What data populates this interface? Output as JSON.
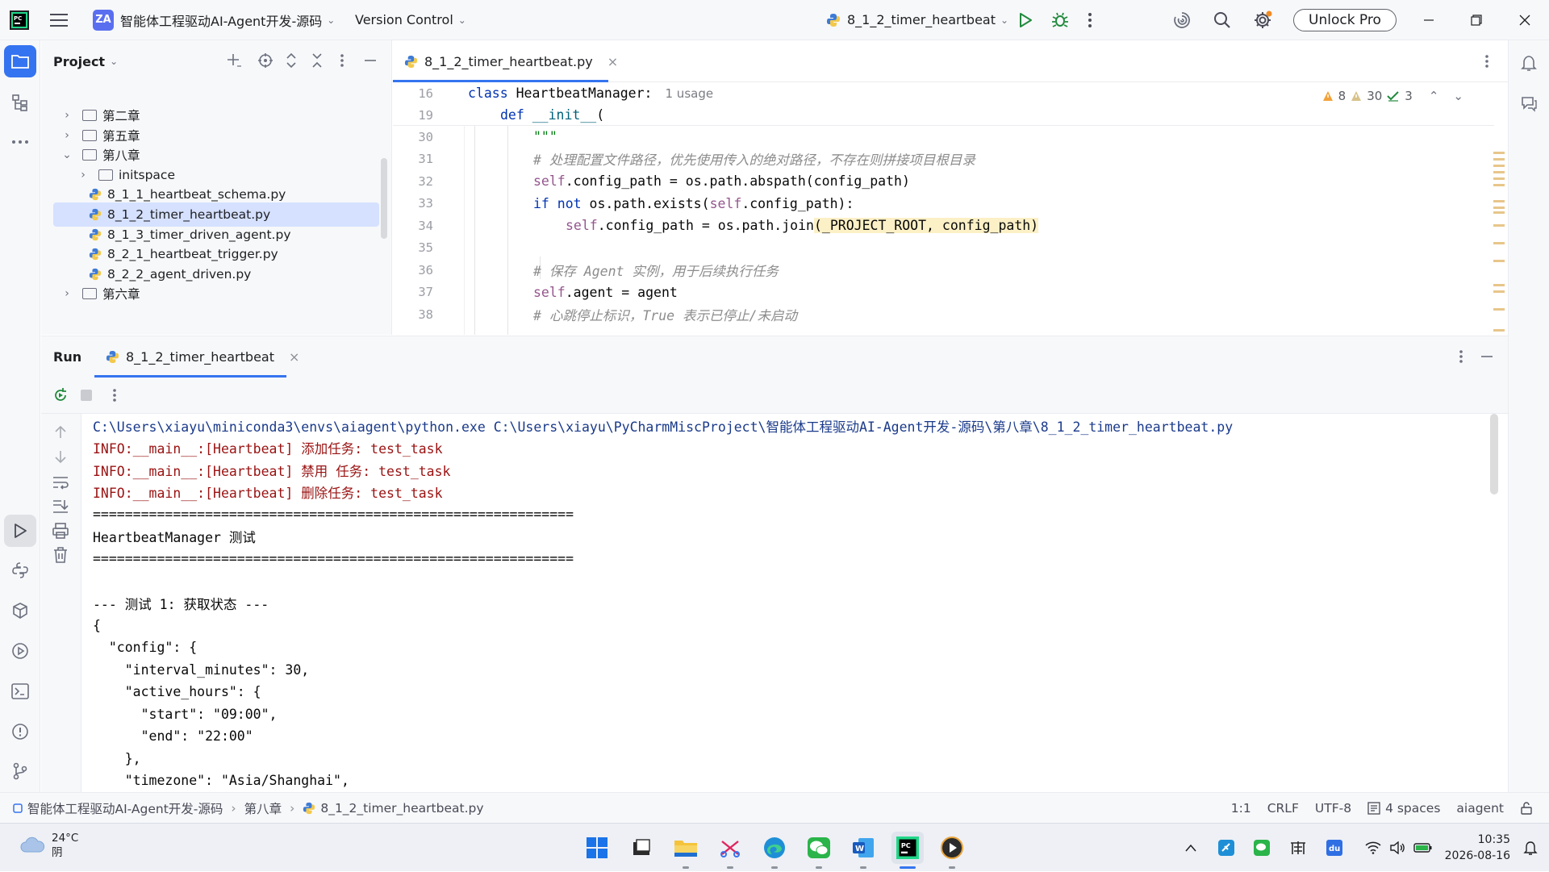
{
  "titlebar": {
    "project_badge": "ZA",
    "project_name": "智能体工程驱动AI-Agent开发-源码",
    "vcs": "Version Control",
    "run_config": "8_1_2_timer_heartbeat",
    "unlock": "Unlock Pro"
  },
  "project_panel": {
    "title": "Project",
    "tree": [
      {
        "label": "第二章",
        "kind": "folder",
        "expanded": false
      },
      {
        "label": "第五章",
        "kind": "folder",
        "expanded": false
      },
      {
        "label": "第八章",
        "kind": "folder",
        "expanded": true
      },
      {
        "label": "initspace",
        "kind": "folder",
        "expanded": false
      },
      {
        "label": "8_1_1_heartbeat_schema.py",
        "kind": "py"
      },
      {
        "label": "8_1_2_timer_heartbeat.py",
        "kind": "py",
        "selected": true
      },
      {
        "label": "8_1_3_timer_driven_agent.py",
        "kind": "py"
      },
      {
        "label": "8_2_1_heartbeat_trigger.py",
        "kind": "py"
      },
      {
        "label": "8_2_2_agent_driven.py",
        "kind": "py"
      },
      {
        "label": "第六章",
        "kind": "folder",
        "expanded": false
      }
    ]
  },
  "editor": {
    "tab": "8_1_2_timer_heartbeat.py",
    "inspections": {
      "warnings": "8",
      "weak_warnings": "30",
      "ok": "3"
    },
    "sticky": [
      {
        "ln": "16",
        "text": "class HeartbeatManager:",
        "usage": "1 usage"
      },
      {
        "ln": "19",
        "text": "def __init__("
      }
    ],
    "lines": [
      {
        "ln": "30",
        "text": "\"\"\""
      },
      {
        "ln": "31",
        "text": "# 处理配置文件路径，优先使用传入的绝对路径，不存在则拼接项目根目录"
      },
      {
        "ln": "32",
        "text": "self.config_path = os.path.abspath(config_path)"
      },
      {
        "ln": "33",
        "text": "if not os.path.exists(self.config_path):"
      },
      {
        "ln": "34",
        "text": "self.config_path = os.path.join(_PROJECT_ROOT, config_path)"
      },
      {
        "ln": "35",
        "text": ""
      },
      {
        "ln": "36",
        "text": "# 保存 Agent 实例，用于后续执行任务"
      },
      {
        "ln": "37",
        "text": "self.agent = agent"
      },
      {
        "ln": "38",
        "text": "# 心跳停止标识，True 表示已停止/未启动"
      }
    ]
  },
  "run_panel": {
    "title": "Run",
    "tab": "8_1_2_timer_heartbeat",
    "console": [
      {
        "kind": "cmd",
        "text": "C:\\Users\\xiayu\\miniconda3\\envs\\aiagent\\python.exe C:\\Users\\xiayu\\PyCharmMiscProject\\智能体工程驱动AI-Agent开发-源码\\第八章\\8_1_2_timer_heartbeat.py"
      },
      {
        "kind": "err",
        "text": "INFO:__main__:[Heartbeat] 添加任务: test_task"
      },
      {
        "kind": "err",
        "text": "INFO:__main__:[Heartbeat] 禁用 任务: test_task"
      },
      {
        "kind": "err",
        "text": "INFO:__main__:[Heartbeat] 删除任务: test_task"
      },
      {
        "kind": "out",
        "text": "============================================================"
      },
      {
        "kind": "out",
        "text": "HeartbeatManager 测试"
      },
      {
        "kind": "out",
        "text": "============================================================"
      },
      {
        "kind": "out",
        "text": ""
      },
      {
        "kind": "out",
        "text": "--- 测试 1: 获取状态 ---"
      },
      {
        "kind": "out",
        "text": "{"
      },
      {
        "kind": "out",
        "text": "  \"config\": {"
      },
      {
        "kind": "out",
        "text": "    \"interval_minutes\": 30,"
      },
      {
        "kind": "out",
        "text": "    \"active_hours\": {"
      },
      {
        "kind": "out",
        "text": "      \"start\": \"09:00\","
      },
      {
        "kind": "out",
        "text": "      \"end\": \"22:00\""
      },
      {
        "kind": "out",
        "text": "    },"
      },
      {
        "kind": "out",
        "text": "    \"timezone\": \"Asia/Shanghai\","
      }
    ]
  },
  "statusbar": {
    "crumbs": [
      "智能体工程驱动AI-Agent开发-源码",
      "第八章",
      "8_1_2_timer_heartbeat.py"
    ],
    "position": "1:1",
    "line_sep": "CRLF",
    "encoding": "UTF-8",
    "indent": "4 spaces",
    "interpreter": "aiagent"
  },
  "taskbar": {
    "temp": "24°C",
    "weather": "阴",
    "time": "10:35",
    "date": "2026-08-16"
  },
  "colors": {
    "accent": "#3574f0",
    "keyword": "#0033b3",
    "comment": "#8c8c8c",
    "self": "#94558d",
    "console_error": "#9a1212",
    "console_cmd": "#1a3a8a"
  }
}
